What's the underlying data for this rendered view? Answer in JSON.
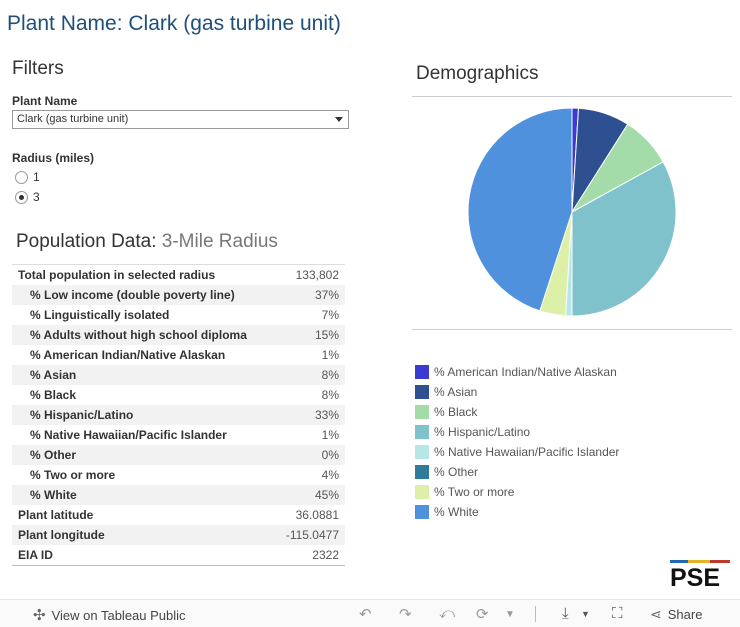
{
  "header": {
    "plant_title": "Plant Name: Clark (gas turbine unit)"
  },
  "filters": {
    "title": "Filters",
    "plant_name_label": "Plant Name",
    "plant_name_value": "Clark (gas turbine unit)",
    "radius_label": "Radius (miles)",
    "radius_options": [
      "1",
      "3"
    ],
    "radius_selected": "3"
  },
  "population": {
    "title": "Population Data:",
    "subtitle": "3-Mile Radius",
    "rows": [
      {
        "label": "Total population in selected radius",
        "value": "133,802"
      },
      {
        "label": "% Low income (double poverty line)",
        "value": "37%"
      },
      {
        "label": "% Linguistically isolated",
        "value": "7%"
      },
      {
        "label": "% Adults without high school diploma",
        "value": "15%"
      },
      {
        "label": "% American Indian/Native Alaskan",
        "value": "1%"
      },
      {
        "label": "% Asian",
        "value": "8%"
      },
      {
        "label": "% Black",
        "value": "8%"
      },
      {
        "label": "% Hispanic/Latino",
        "value": "33%"
      },
      {
        "label": "% Native Hawaiian/Pacific Islander",
        "value": "1%"
      },
      {
        "label": "% Other",
        "value": "0%"
      },
      {
        "label": "% Two or more",
        "value": "4%"
      },
      {
        "label": "% White",
        "value": "45%"
      },
      {
        "label": "Plant latitude",
        "value": "36.0881"
      },
      {
        "label": "Plant longitude",
        "value": "-115.0477"
      },
      {
        "label": "EIA ID",
        "value": "2322"
      }
    ]
  },
  "demographics": {
    "title": "Demographics"
  },
  "chart_data": {
    "type": "pie",
    "title": "Demographics",
    "categories": [
      "% American Indian/Native Alaskan",
      "% Asian",
      "% Black",
      "% Hispanic/Latino",
      "% Native Hawaiian/Pacific Islander",
      "% Other",
      "% Two or more",
      "% White"
    ],
    "values": [
      1,
      8,
      8,
      33,
      1,
      0,
      4,
      45
    ],
    "colors": [
      "#3b3bd1",
      "#2e5090",
      "#a3dca8",
      "#80c2cc",
      "#b7e6e6",
      "#2e7c99",
      "#dcf0a8",
      "#5091dd"
    ],
    "legend": "bottom"
  },
  "branding": {
    "logo_text": "PSE",
    "logo_stripe_colors": [
      "#1f6ab3",
      "#e2b428",
      "#c0392b"
    ]
  },
  "toolbar": {
    "view_label": "View on Tableau Public",
    "share_label": "Share",
    "icons": [
      "tableau-icon",
      "undo-icon",
      "redo-icon",
      "revert-icon",
      "refresh-icon",
      "download-icon",
      "fullscreen-icon",
      "share-icon"
    ]
  }
}
